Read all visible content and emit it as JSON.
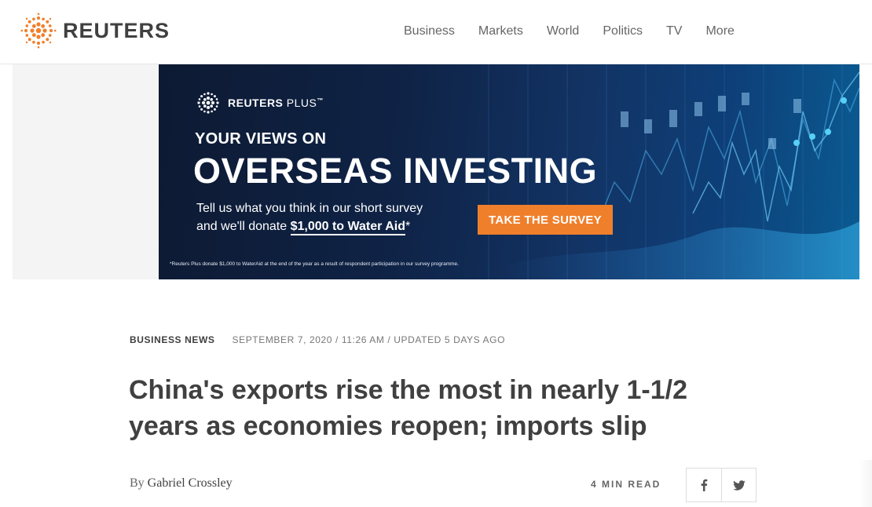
{
  "header": {
    "logo_text": "REUTERS",
    "nav": [
      {
        "label": "Business"
      },
      {
        "label": "Markets"
      },
      {
        "label": "World"
      },
      {
        "label": "Politics"
      },
      {
        "label": "TV"
      },
      {
        "label": "More"
      }
    ]
  },
  "ad": {
    "brand": "REUTERS",
    "brand_suffix": "PLUS",
    "brand_tm": "™",
    "line1": "YOUR VIEWS ON",
    "line2": "OVERSEAS INVESTING",
    "copy_1": "Tell us what you think in our short survey",
    "copy_2": "and we'll donate ",
    "copy_strong": "$1,000 to Water Aid",
    "copy_star": "*",
    "cta": "TAKE THE SURVEY",
    "fineprint": "*Reuters Plus donate $1,000 to WaterAid at the end of the year as a result of respondent participation in our survey programme."
  },
  "article": {
    "section": "BUSINESS NEWS",
    "dateline": "SEPTEMBER 7, 2020 / 11:26 AM / UPDATED 5 DAYS AGO",
    "headline": "China's exports rise the most in nearly 1-1/2 years as economies reopen; imports slip",
    "byline_prefix": "By ",
    "author": "Gabriel Crossley",
    "read_time": "4 MIN READ"
  },
  "share": {
    "facebook_icon": "facebook-icon",
    "twitter_icon": "twitter-icon"
  },
  "colors": {
    "brand_orange": "#f07f2b",
    "text_dark": "#404040",
    "ad_navy": "#0f2346",
    "ad_blue": "#0a5b92"
  }
}
